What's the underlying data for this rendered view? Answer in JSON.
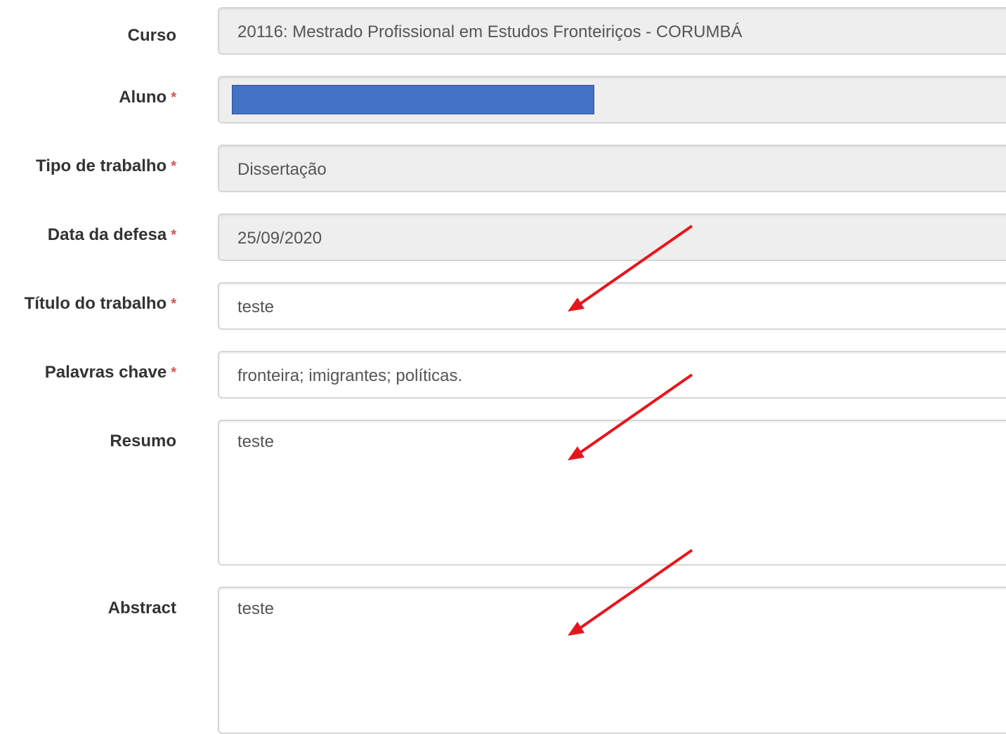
{
  "form": {
    "course": {
      "label": "Curso",
      "value": "20116: Mestrado Profissional em Estudos Fronteiriços - CORUMBÁ"
    },
    "student": {
      "label": "Aluno",
      "required_marker": "*"
    },
    "work_type": {
      "label": "Tipo de trabalho",
      "required_marker": "*",
      "value": "Dissertação"
    },
    "defense_date": {
      "label": "Data da defesa",
      "required_marker": "*",
      "value": "25/09/2020"
    },
    "work_title": {
      "label": "Título do trabalho",
      "required_marker": "*",
      "value": "teste"
    },
    "keywords": {
      "label": "Palavras chave",
      "required_marker": "*",
      "value": "fronteira; imigrantes; políticas."
    },
    "summary": {
      "label": "Resumo",
      "value": "teste"
    },
    "abstract": {
      "label": "Abstract",
      "value": "teste"
    }
  },
  "colors": {
    "readonly_bg": "#eeeeee",
    "required_marker": "#d9534f",
    "redaction": "#4472c4",
    "annotation_arrow": "#e8141c"
  },
  "annotations": {
    "arrows_icon": "red-arrow-icon"
  }
}
